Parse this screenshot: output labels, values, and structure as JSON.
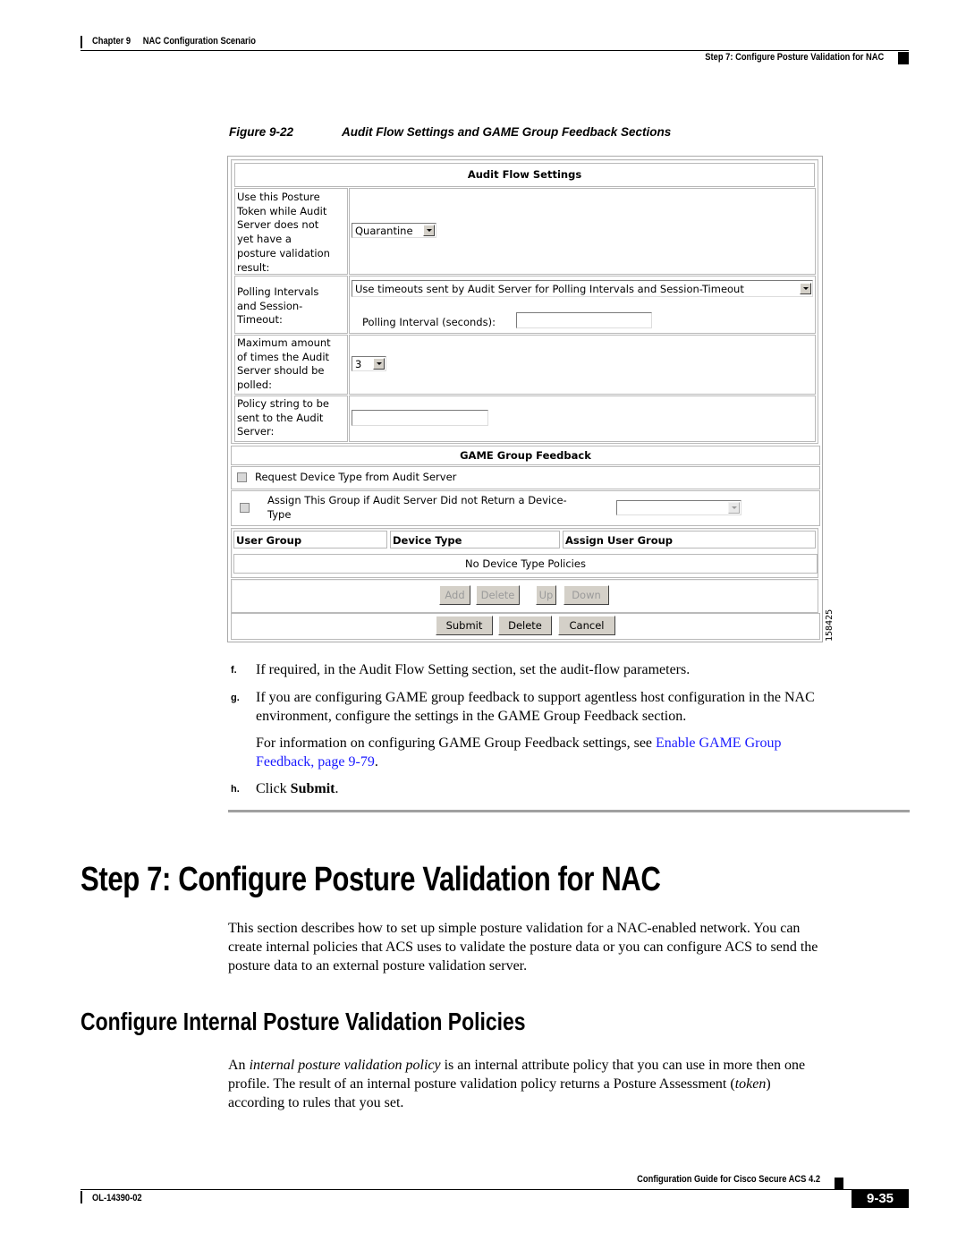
{
  "header": {
    "chapter_label": "Chapter 9",
    "chapter_title": "NAC Configuration Scenario",
    "section": "Step 7: Configure Posture Validation for NAC"
  },
  "figure": {
    "label": "Figure 9-22",
    "caption": "Audit Flow Settings and GAME Group Feedback Sections",
    "id_number": "158425",
    "audit_flow": {
      "title": "Audit Flow Settings",
      "token_label": [
        "Use this Posture",
        "Token while Audit",
        "Server does not",
        "yet have a",
        "posture validation",
        "result:"
      ],
      "token_value": "Quarantine",
      "polling_label": [
        "Polling Intervals",
        "and Session-",
        "Timeout:"
      ],
      "polling_value": "Use timeouts sent by Audit Server for Polling Intervals and Session-Timeout",
      "polling_interval_label": "Polling Interval (seconds):",
      "polling_interval_value": "",
      "max_label": [
        "Maximum amount",
        "of times the Audit",
        "Server should be",
        "polled:"
      ],
      "max_value": "3",
      "policy_label": [
        "Policy string to be",
        "sent to the Audit",
        "Server:"
      ],
      "policy_value": ""
    },
    "game_feedback": {
      "title": "GAME Group Feedback",
      "request_device_type": "Request Device Type from Audit Server",
      "assign_group_line1": "Assign This Group if Audit Server Did not Return a Device-",
      "assign_group_line2": "Type",
      "assign_group_value": "",
      "columns": [
        "User Group",
        "Device Type",
        "Assign User Group"
      ],
      "empty_message": "No Device Type Policies",
      "row_buttons": {
        "add": "Add",
        "delete": "Delete",
        "up": "Up",
        "down": "Down"
      },
      "form_buttons": {
        "submit": "Submit",
        "delete": "Delete",
        "cancel": "Cancel"
      }
    }
  },
  "steps": {
    "f": {
      "letter": "f.",
      "text": "If required, in the Audit Flow Setting section, set the audit-flow parameters."
    },
    "g": {
      "letter": "g.",
      "line1": "If you are configuring GAME group feedback to support agentless host configuration in the NAC",
      "line2": "environment, configure the settings in the GAME Group Feedback section.",
      "info_prefix": "For information on configuring GAME Group Feedback settings, see ",
      "link_line1": "Enable GAME Group",
      "link_line2": "Feedback, page 9-79",
      "info_suffix": "."
    },
    "h": {
      "letter": "h.",
      "prefix": "Click ",
      "bold": "Submit",
      "suffix": "."
    }
  },
  "section": {
    "title": "Step 7: Configure Posture Validation for NAC",
    "para": [
      "This section describes how to set up simple posture validation for a NAC-enabled network. You can",
      "create internal policies that ACS uses to validate the posture data or you can configure ACS to send the",
      "posture data to an external posture validation server."
    ]
  },
  "subsection": {
    "title": "Configure Internal Posture Validation Policies",
    "p_an": "An ",
    "p_italic1": "internal posture validation policy",
    "p_rest1": " is an internal attribute policy that you can use in more then one",
    "p_line2a": "profile. The result of an internal posture validation policy returns a Posture Assessment (",
    "p_italic2": "token",
    "p_line2b": ")",
    "p_line3": "according to rules that you set."
  },
  "footer": {
    "guide": "Configuration Guide for Cisco Secure ACS 4.2",
    "doc_number": "OL-14390-02",
    "page": "9-35"
  }
}
